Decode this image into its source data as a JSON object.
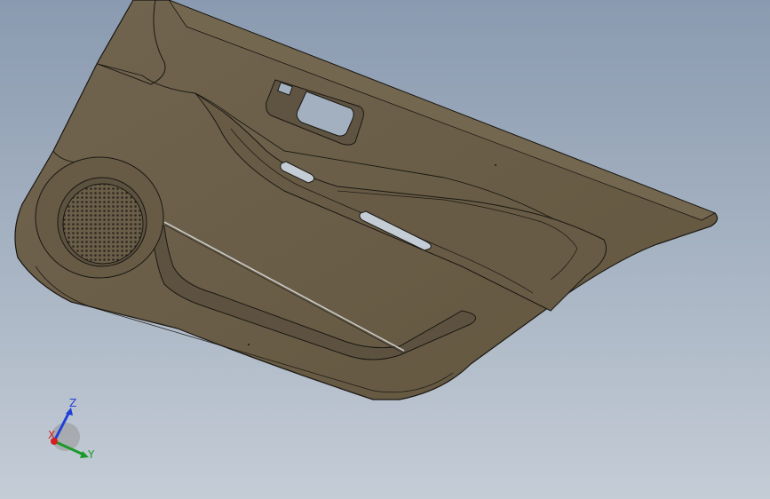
{
  "viewport": {
    "background_top": "#8a9ab0",
    "background_bottom": "#c4ccd6"
  },
  "model": {
    "panel_color": "#6b5e48",
    "panel_shade": "#5d5240",
    "edge_color": "#1a1712",
    "speaker_grille": "#2b2620"
  },
  "triad": {
    "z_label": "Z",
    "y_label": "Y",
    "x_label": "X",
    "z_color": "#1f3fd8",
    "y_color": "#1a9a2a",
    "x_color": "#d42020"
  }
}
